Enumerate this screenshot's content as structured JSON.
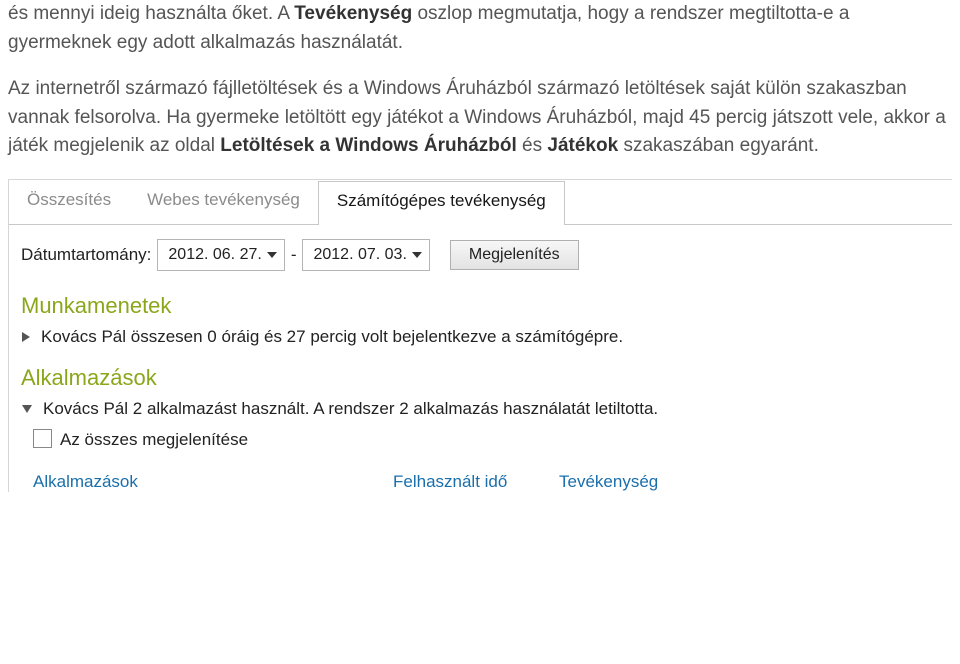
{
  "doc": {
    "p1_lead": "és mennyi ideig használta őket. A ",
    "p1_strong": "Tevékenység",
    "p1_tail": " oszlop megmutatja, hogy a rendszer megtiltotta-e a gyermeknek egy adott alkalmazás használatát.",
    "p2_a": "Az internetről származó fájlletöltések és a Windows Áruházból származó letöltések saját külön szakaszban vannak felsorolva. Ha gyermeke letöltött egy játékot a Windows Áruházból, majd 45 percig játszott vele, akkor a játék megjelenik az oldal ",
    "p2_b": "Letöltések a Windows Áruházból",
    "p2_c": " és ",
    "p2_d": "Játékok",
    "p2_e": " szakaszában egyaránt."
  },
  "shot": {
    "tabs": {
      "summary": "Összesítés",
      "web": "Webes tevékenység",
      "pc": "Számítógépes tevékenység"
    },
    "date": {
      "label": "Dátumtartomány:",
      "from": "2012. 06. 27.",
      "sep": "-",
      "to": "2012. 07. 03.",
      "show": "Megjelenítés"
    },
    "sessions": {
      "header": "Munkamenetek",
      "line": "Kovács Pál összesen 0 óráig és 27 percig volt bejelentkezve a számítógépre."
    },
    "apps": {
      "header": "Alkalmazások",
      "line": "Kovács Pál 2 alkalmazást használt. A rendszer 2 alkalmazás használatát letiltotta.",
      "showall": "Az összes megjelenítése",
      "col_app": "Alkalmazások",
      "col_time": "Felhasznált idő",
      "col_act": "Tevékenység"
    }
  }
}
